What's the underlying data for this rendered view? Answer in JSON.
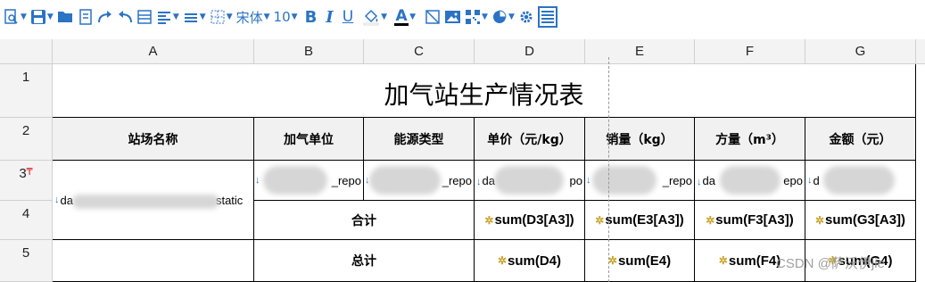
{
  "toolbar": {
    "font_name": "宋体",
    "font_size": "10",
    "bold": "B",
    "italic": "I",
    "underline": "U",
    "font_color": "A"
  },
  "columns": [
    "A",
    "B",
    "C",
    "D",
    "E",
    "F",
    "G"
  ],
  "rows": [
    "1",
    "2",
    "3",
    "4",
    "5"
  ],
  "sheet": {
    "title": "加气站生产情况表",
    "headers": [
      "站场名称",
      "加气单位",
      "能源类型",
      "单价（元/kg）",
      "销量（kg）",
      "方量（m³）",
      "金额（元）"
    ],
    "row3": {
      "a": "da",
      "a_tail": "static",
      "b": "_repo",
      "c": "_repo",
      "d": "da",
      "d_tail": "po",
      "e": "_repo",
      "f": "da",
      "f_tail": "epo",
      "g": "d"
    },
    "row4": {
      "label": "合计",
      "d": "sum(D3[A3])",
      "e": "sum(E3[A3])",
      "f": "sum(F3[A3])",
      "g": "sum(G3[A3])"
    },
    "row5": {
      "label": "总计",
      "d": "sum(D4)",
      "e": "sum(E4)",
      "f": "sum(F4)",
      "g": "sum(G4)"
    }
  },
  "watermark": "CSDN @萨沃伊jie",
  "colors": {
    "accent": "#2a73c5",
    "header_bg": "#f3f3f3",
    "formula_star": "#c9a227"
  }
}
